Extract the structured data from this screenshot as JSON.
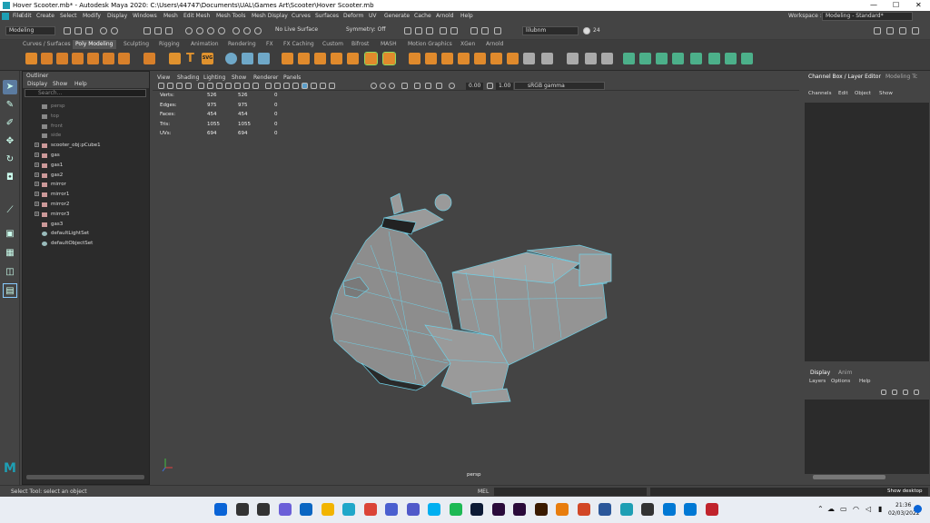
{
  "window": {
    "title": "Hover Scooter.mb* - Autodesk Maya 2020: C:\\Users\\44747\\Documents\\UAL\\Games Art\\Scooter\\Hover Scooter.mb",
    "minimize": "—",
    "maximize": "☐",
    "close": "✕"
  },
  "menubar": {
    "items": [
      "File",
      "Edit",
      "Create",
      "Select",
      "Modify",
      "Display",
      "Windows",
      "Mesh",
      "Edit Mesh",
      "Mesh Tools",
      "Mesh Display",
      "Curves",
      "Surfaces",
      "Deform",
      "UV",
      "Generate",
      "Cache",
      "Arnold",
      "Help"
    ],
    "workspace_label": "Workspace :",
    "workspace_value": "Modeling - Standard*"
  },
  "statusline": {
    "mode": "Modeling",
    "live_surface": "No Live Surface",
    "symmetry": "Symmetry: Off",
    "user": "lilubnm",
    "notifications": "24"
  },
  "shelf": {
    "tabs": [
      "Curves / Surfaces",
      "Poly Modeling",
      "Sculpting",
      "Rigging",
      "Animation",
      "Rendering",
      "FX",
      "FX Caching",
      "Custom",
      "Bifrost",
      "MASH",
      "Motion Graphics",
      "XGen",
      "Arnold"
    ],
    "active_tab": "Poly Modeling",
    "svg_label": "SVG"
  },
  "outliner": {
    "title": "Outliner",
    "menu": [
      "Display",
      "Show",
      "Help"
    ],
    "search_placeholder": "Search...",
    "items": [
      {
        "label": "persp",
        "type": "camera",
        "dim": true
      },
      {
        "label": "top",
        "type": "camera",
        "dim": true
      },
      {
        "label": "front",
        "type": "camera",
        "dim": true
      },
      {
        "label": "side",
        "type": "camera",
        "dim": true
      },
      {
        "label": "scooter_obj:pCube1",
        "type": "mesh",
        "dim": false
      },
      {
        "label": "gas",
        "type": "mesh",
        "dim": false
      },
      {
        "label": "gas1",
        "type": "mesh",
        "dim": false
      },
      {
        "label": "gas2",
        "type": "mesh",
        "dim": false
      },
      {
        "label": "mirror",
        "type": "mesh",
        "dim": false
      },
      {
        "label": "mirror1",
        "type": "mesh",
        "dim": false
      },
      {
        "label": "mirror2",
        "type": "mesh",
        "dim": false
      },
      {
        "label": "mirror3",
        "type": "mesh",
        "dim": false
      },
      {
        "label": "gas3",
        "type": "mesh-single",
        "dim": false
      },
      {
        "label": "defaultLightSet",
        "type": "set",
        "dim": false
      },
      {
        "label": "defaultObjectSet",
        "type": "set",
        "dim": false
      }
    ]
  },
  "viewport": {
    "menu": [
      "View",
      "Shading",
      "Lighting",
      "Show",
      "Renderer",
      "Panels"
    ],
    "exposure": "0.00",
    "gamma": "1.00",
    "color_space": "sRGB gamma",
    "camera_label": "persp",
    "hud": [
      {
        "label": "Verts:",
        "a": "526",
        "b": "526",
        "c": "0"
      },
      {
        "label": "Edges:",
        "a": "975",
        "b": "975",
        "c": "0"
      },
      {
        "label": "Faces:",
        "a": "454",
        "b": "454",
        "c": "0"
      },
      {
        "label": "Tris:",
        "a": "1055",
        "b": "1055",
        "c": "0"
      },
      {
        "label": "UVs:",
        "a": "694",
        "b": "694",
        "c": "0"
      }
    ]
  },
  "channelbox": {
    "tabs": [
      "Channel Box / Layer Editor",
      "Modeling Tc"
    ],
    "menu": [
      "Channels",
      "Edit",
      "Object",
      "Show"
    ],
    "layer_tabs": [
      "Display",
      "Anim"
    ],
    "layer_menu": [
      "Layers",
      "Options",
      "Help"
    ]
  },
  "commandline": {
    "help_text": "Select Tool: select an object",
    "mel_label": "MEL"
  },
  "taskbar": {
    "time": "21:36",
    "date": "02/03/2022",
    "tooltip": "Show desktop",
    "app_icons": [
      {
        "name": "windows-start-icon",
        "color": "#0a64d6"
      },
      {
        "name": "search-icon",
        "color": "#333333"
      },
      {
        "name": "task-view-icon",
        "color": "#333333"
      },
      {
        "name": "chat-icon",
        "color": "#6b5fd8"
      },
      {
        "name": "outlook-icon",
        "color": "#0a66c2"
      },
      {
        "name": "file-explorer-icon",
        "color": "#f2b400"
      },
      {
        "name": "edge-icon",
        "color": "#1fa7c9"
      },
      {
        "name": "chrome-icon",
        "color": "#db4437"
      },
      {
        "name": "store-icon",
        "color": "#4a5fcf"
      },
      {
        "name": "teams-icon",
        "color": "#5059c9"
      },
      {
        "name": "skype-icon",
        "color": "#00aff0"
      },
      {
        "name": "spotify-icon",
        "color": "#1db954"
      },
      {
        "name": "photoshop-icon",
        "color": "#0d1a35"
      },
      {
        "name": "premiere-icon",
        "color": "#2a0a3a"
      },
      {
        "name": "after-effects-icon",
        "color": "#2a0a3a"
      },
      {
        "name": "illustrator-icon",
        "color": "#3a1a00"
      },
      {
        "name": "blender-icon",
        "color": "#e87d0d"
      },
      {
        "name": "powerpoint-icon",
        "color": "#d24726"
      },
      {
        "name": "word-icon",
        "color": "#2b579a"
      },
      {
        "name": "maya-icon",
        "color": "#1e9fb4"
      },
      {
        "name": "photos-icon",
        "color": "#333333"
      },
      {
        "name": "mail-icon",
        "color": "#0078d4"
      },
      {
        "name": "snipping-icon",
        "color": "#0078d4"
      },
      {
        "name": "substance-icon",
        "color": "#c0232c"
      }
    ]
  }
}
